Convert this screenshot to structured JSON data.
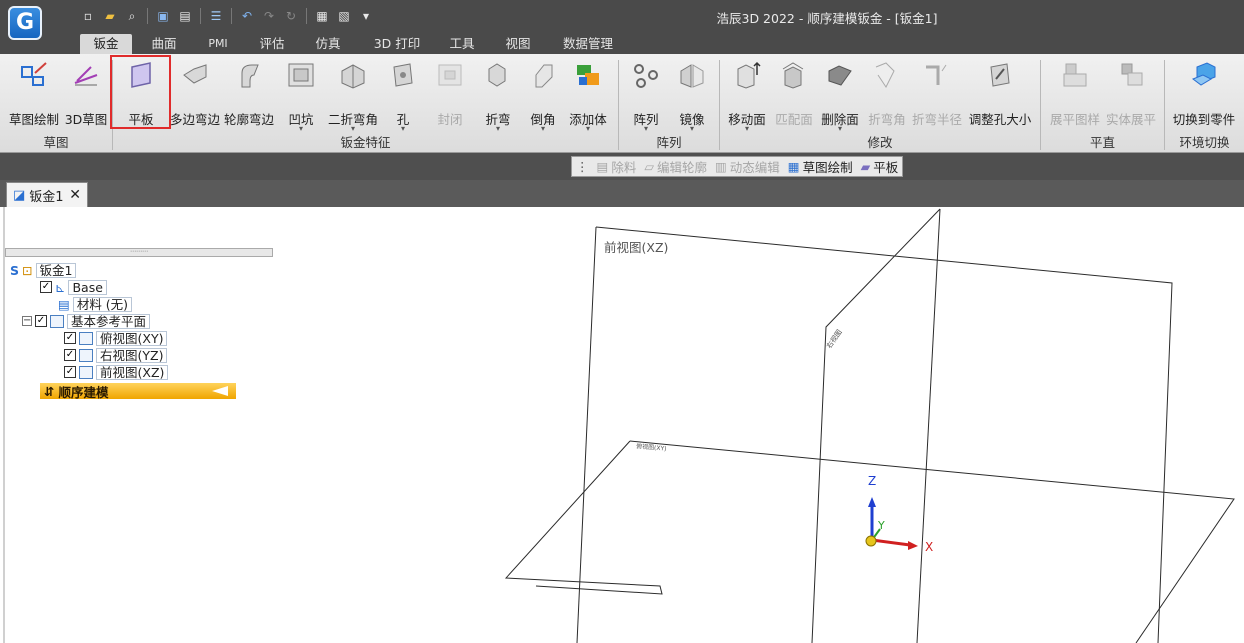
{
  "app": {
    "logo_letter": "G",
    "title": "浩辰3D 2022 - 顺序建模钣金 - [钣金1]"
  },
  "quick_access": [
    "new-icon",
    "open-icon",
    "search-icon",
    "save-icon",
    "save-as-icon",
    "properties-icon",
    "undo-icon",
    "redo-icon",
    "repeat-icon",
    "clipboard-icon",
    "options-icon",
    "customize-icon"
  ],
  "tabs": [
    {
      "label": "钣金",
      "active": true
    },
    {
      "label": "曲面"
    },
    {
      "label": "PMI"
    },
    {
      "label": "评估"
    },
    {
      "label": "仿真"
    },
    {
      "label": "3D 打印"
    },
    {
      "label": "工具"
    },
    {
      "label": "视图"
    },
    {
      "label": "数据管理"
    }
  ],
  "ribbon": {
    "buttons": [
      {
        "label": "草图绘制",
        "icon": "sketch-icon"
      },
      {
        "label": "3D草图",
        "icon": "3d-sketch-icon"
      },
      {
        "label": "平板",
        "icon": "plate-icon"
      },
      {
        "label": "多边弯边",
        "icon": "multi-flange-icon"
      },
      {
        "label": "轮廓弯边",
        "icon": "contour-flange-icon"
      },
      {
        "label": "凹坑",
        "icon": "dimple-icon"
      },
      {
        "label": "二折弯角",
        "icon": "bend-corner-icon"
      },
      {
        "label": "孔",
        "icon": "hole-icon"
      },
      {
        "label": "封闭",
        "icon": "close-corner-icon",
        "disabled": true
      },
      {
        "label": "折弯",
        "icon": "bend-icon"
      },
      {
        "label": "倒角",
        "icon": "chamfer-icon"
      },
      {
        "label": "添加体",
        "icon": "add-body-icon"
      },
      {
        "label": "阵列",
        "icon": "pattern-icon"
      },
      {
        "label": "镜像",
        "icon": "mirror-icon"
      },
      {
        "label": "移动面",
        "icon": "move-face-icon"
      },
      {
        "label": "匹配面",
        "icon": "match-face-icon",
        "disabled": true
      },
      {
        "label": "删除面",
        "icon": "delete-face-icon"
      },
      {
        "label": "折弯角",
        "icon": "bend-angle-icon",
        "disabled": true
      },
      {
        "label": "折弯半径",
        "icon": "bend-radius-icon",
        "disabled": true
      },
      {
        "label": "调整孔大小",
        "icon": "resize-hole-icon"
      },
      {
        "label": "展平图样",
        "icon": "flat-pattern-icon",
        "disabled": true
      },
      {
        "label": "实体展平",
        "icon": "solid-flatten-icon",
        "disabled": true
      },
      {
        "label": "切换到零件",
        "icon": "switch-part-icon"
      }
    ],
    "groups": [
      "草图",
      "钣金特征",
      "阵列",
      "修改",
      "平直",
      "环境切换"
    ]
  },
  "context_toolbar": [
    {
      "label": "除料",
      "disabled": true
    },
    {
      "label": "编辑轮廓",
      "disabled": true
    },
    {
      "label": "动态编辑",
      "disabled": true
    },
    {
      "label": "草图绘制"
    },
    {
      "label": "平板"
    }
  ],
  "document_tab": {
    "label": "钣金1",
    "close": "✕"
  },
  "tree": {
    "root": "钣金1",
    "base": "Base",
    "material": "材料 (无)",
    "ref_planes": "基本参考平面",
    "planes": [
      "俯视图(XY)",
      "右视图(YZ)",
      "前视图(XZ)"
    ],
    "sequential": "顺序建模"
  },
  "viewport": {
    "front_plane_label": "前视图(XZ)",
    "axis_z": "Z",
    "axis_y": "Y",
    "axis_x": "X"
  }
}
